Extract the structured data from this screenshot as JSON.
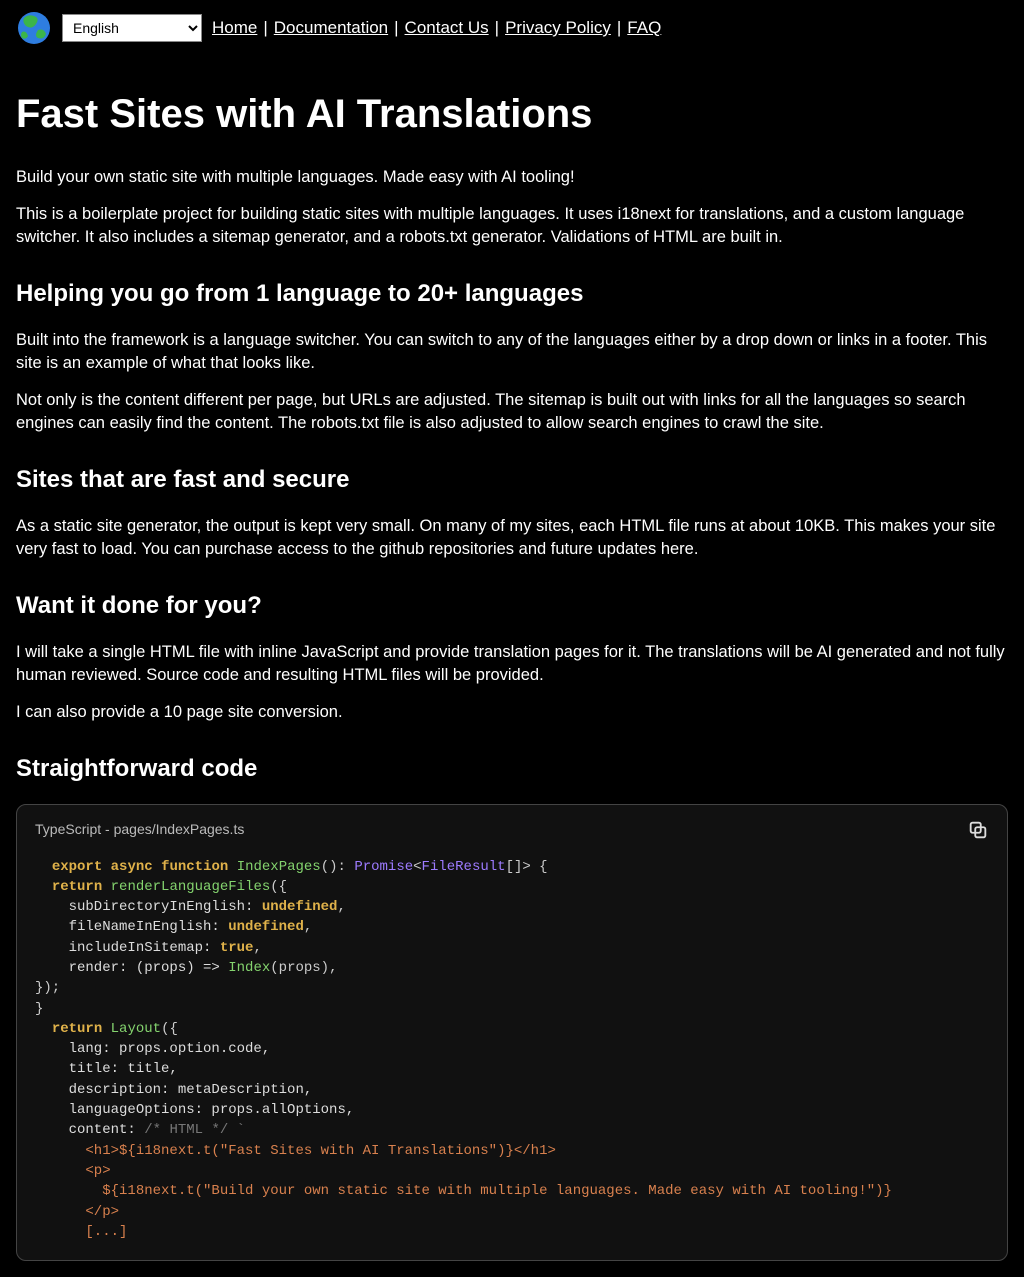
{
  "header": {
    "language_selected": "English",
    "nav": {
      "home": "Home",
      "documentation": "Documentation",
      "contact": "Contact Us",
      "privacy": "Privacy Policy",
      "faq": "FAQ",
      "sep": "|"
    }
  },
  "page": {
    "h1": "Fast Sites with AI Translations",
    "p1": "Build your own static site with multiple languages. Made easy with AI tooling!",
    "p2": "This is a boilerplate project for building static sites with multiple languages. It uses i18next for translations, and a custom language switcher. It also includes a sitemap generator, and a robots.txt generator. Validations of HTML are built in.",
    "h2a": "Helping you go from 1 language to 20+ languages",
    "p3": "Built into the framework is a language switcher. You can switch to any of the languages either by a drop down or links in a footer. This site is an example of what that looks like.",
    "p4": "Not only is the content different per page, but URLs are adjusted. The sitemap is built out with links for all the languages so search engines can easily find the content. The robots.txt file is also adjusted to allow search engines to crawl the site.",
    "h2b": "Sites that are fast and secure",
    "p5": "As a static site generator, the output is kept very small. On many of my sites, each HTML file runs at about 10KB. This makes your site very fast to load. You can purchase access to the github repositories and future updates here.",
    "h2c": "Want it done for you?",
    "p6": "I will take a single HTML file with inline JavaScript and provide translation pages for it. The translations will be AI generated and not fully human reviewed. Source code and resulting HTML files will be provided.",
    "p7": "I can also provide a 10 page site conversion.",
    "h2d": "Straightforward code"
  },
  "code": {
    "header": "TypeScript - pages/IndexPages.ts",
    "l1_export": "export",
    "l1_async": "async",
    "l1_function": "function",
    "l1_name": "IndexPages",
    "l1_paren": "():",
    "l1_promise": "Promise",
    "l1_lt": "<",
    "l1_fr": "FileResult",
    "l1_tail": "[]> {",
    "l2_return": "return",
    "l2_fn": "renderLanguageFiles",
    "l2_tail": "({",
    "l3_key": "    subDirectoryInEnglish:",
    "l3_val": "undefined",
    "l3_tail": ",",
    "l4_key": "    fileNameInEnglish:",
    "l4_val": "undefined",
    "l4_tail": ",",
    "l5_key": "    includeInSitemap:",
    "l5_val": "true",
    "l5_tail": ",",
    "l6_key": "    render: (props) =>",
    "l6_fn": "Index",
    "l6_tail": "(props),",
    "l7": "});",
    "l8": "}",
    "l9_return": "return",
    "l9_fn": "Layout",
    "l9_tail": "({",
    "l10": "    lang: props.option.code,",
    "l11": "    title: title,",
    "l12": "    description: metaDescription,",
    "l13": "    languageOptions: props.allOptions,",
    "l14_key": "    content:",
    "l14_cm": "/* HTML */ `",
    "l15": "      <h1>${i18next.t(\"Fast Sites with AI Translations\")}</h1>",
    "l16": "      <p>",
    "l17": "        ${i18next.t(\"Build your own static site with multiple languages. Made easy with AI tooling!\")}",
    "l18": "      </p>",
    "l19": "      [...]"
  }
}
